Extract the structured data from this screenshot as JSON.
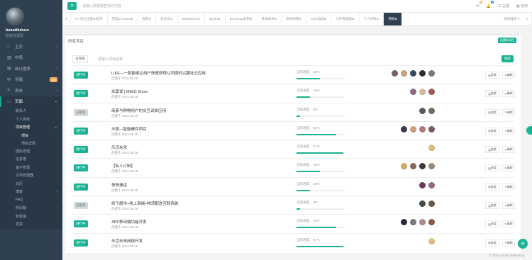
{
  "user": {
    "name": "beautifulsun",
    "role": "超级管理员"
  },
  "sidebar": {
    "items": [
      {
        "label": "主页",
        "icon": "home-icon",
        "arrow": "‹"
      },
      {
        "label": "布局",
        "icon": "columns-icon"
      },
      {
        "label": "统计图表",
        "icon": "chart-icon",
        "arrow": "‹"
      },
      {
        "label": "信箱",
        "icon": "envelope-icon",
        "badge": "16"
      },
      {
        "label": "表单",
        "icon": "edit-icon",
        "arrow": "‹"
      },
      {
        "label": "页面",
        "icon": "desktop-icon",
        "arrow": "⌄",
        "active": true
      }
    ],
    "sub_items": [
      {
        "label": "联系人"
      },
      {
        "label": "个人资料"
      },
      {
        "label": "项目管理",
        "arrow": "⌄",
        "active": true
      }
    ],
    "sub_sub_items": [
      {
        "label": "项目",
        "active": true
      },
      {
        "label": "项目详情"
      }
    ],
    "more_items": [
      {
        "label": "团队管理"
      },
      {
        "label": "信息墙"
      },
      {
        "label": "客户管理"
      },
      {
        "label": "文件管理器"
      },
      {
        "label": "日历"
      },
      {
        "label": "博客",
        "arrow": "‹"
      },
      {
        "label": "FAQ"
      },
      {
        "label": "时间轴",
        "arrow": "‹"
      },
      {
        "label": "标签墙"
      },
      {
        "label": "发票"
      }
    ]
  },
  "topbar": {
    "search_placeholder": "请输入您需要查找的内容 …",
    "messages_count": "8",
    "alerts_count": "4",
    "theme_label": "主题",
    "more_label": "常用"
  },
  "tabs": [
    {
      "label": "H+ 后台主题UI框架"
    },
    {
      "label": "百度ECHarts"
    },
    {
      "label": "视频"
    },
    {
      "label": "标签页"
    },
    {
      "label": "Datatables"
    },
    {
      "label": "jqGrid"
    },
    {
      "label": "Bootstrap表格"
    },
    {
      "label": "基本表单"
    },
    {
      "label": "表单构建"
    },
    {
      "label": "CSS动画"
    },
    {
      "label": "文件管理器"
    },
    {
      "label": "个人资料"
    },
    {
      "label": "项目",
      "active": true
    }
  ],
  "tabs_close_label": "关闭操作",
  "page": {
    "title": "所有项目",
    "new_button": "创建新项目",
    "status_filter": "已完成",
    "search_placeholder": "请输入项目名称",
    "search_button": "搜索",
    "view_label": "查看",
    "edit_label": "编辑"
  },
  "progress_prefix": "当前进度：",
  "projects": [
    {
      "status": "进行中",
      "status_color": "green",
      "name": "LIKE—一款能够让用户快速获得认同感的兴趣社交应用",
      "date": "创建于 2014.08.15",
      "progress": 48,
      "avatars": [
        "#7a5c6b",
        "#c9a27a",
        "#3a4a5c",
        "#2b2b2b",
        "#6f7f7f"
      ]
    },
    {
      "status": "进行中",
      "status_color": "green",
      "name": "米莫说 | MiMO Show",
      "date": "创建于 2014.08.15",
      "progress": 28,
      "avatars": [
        "#8a6a8a",
        "#d9b89a",
        "#a05a5a"
      ]
    },
    {
      "status": "已取消",
      "status_color": "gray",
      "name": "商家与购物用户的交互试衣应用",
      "date": "创建于 2014.08.15",
      "progress": 8,
      "avatars": [
        "#5a5a5a",
        "#7a6a5a"
      ]
    },
    {
      "status": "进行中",
      "status_color": "green",
      "name": "天狼—智能硬件项目",
      "date": "创建于 2014.08.15",
      "progress": 83,
      "avatars": [
        "#3a3a4a",
        "#c9a27a",
        "#b07a7a",
        "#7a5a6a"
      ]
    },
    {
      "status": "进行中",
      "status_color": "green",
      "name": "乐活未来",
      "date": "创建于 2014.08.15",
      "progress": 97,
      "avatars": [
        "#e0c080"
      ]
    },
    {
      "status": "进行中",
      "status_color": "green",
      "name": "【私人订制】",
      "date": "创建于 2014.08.15",
      "progress": 48,
      "avatars": [
        "#d9a860",
        "#8a6a5a",
        "#3a3a3a",
        "#9a8a7a"
      ]
    },
    {
      "status": "进行中",
      "status_color": "green",
      "name": "快狗速运",
      "date": "创建于 2014.08.15",
      "progress": 28,
      "avatars": [
        "#6a3a5a",
        "#9a6a8a"
      ]
    },
    {
      "status": "已取消",
      "status_color": "gray",
      "name": "线下超市+线上商城+物流配送互联系统",
      "date": "创建于 2014.08.15",
      "progress": 8,
      "avatars": [
        "#4a4a4a",
        "#6a5a4a"
      ]
    },
    {
      "status": "进行中",
      "status_color": "green",
      "name": "APP移动端功能开发",
      "date": "创建于 2014.08.15",
      "progress": 83,
      "avatars": [
        "#2a2a3a",
        "#7a7a7a",
        "#b08a8a",
        "#8a5a4a"
      ]
    },
    {
      "status": "进行中",
      "status_color": "green",
      "name": "乐活未来网络开发",
      "date": "创建于 2014.08.15",
      "progress": 97,
      "avatars": [
        "#e0c080"
      ]
    }
  ],
  "footer": "© 2014-2015 charle.blog"
}
